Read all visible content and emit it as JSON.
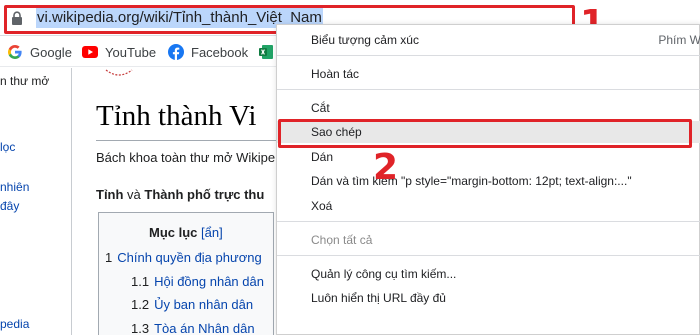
{
  "address_bar": {
    "url": "vi.wikipedia.org/wiki/Tỉnh_thành_Việt_Nam"
  },
  "annotations": {
    "step1": "1",
    "step2": "2"
  },
  "bookmarks": [
    {
      "label": "Google",
      "icon": "google-icon"
    },
    {
      "label": "YouTube",
      "icon": "youtube-icon"
    },
    {
      "label": "Facebook",
      "icon": "facebook-icon"
    },
    {
      "label": "",
      "icon": "excel-icon"
    }
  ],
  "left_rail": {
    "lines": [
      "n thư mở",
      "lọc",
      "nhiên",
      "đây",
      "pedia"
    ]
  },
  "article": {
    "title": "Tỉnh thành Vi",
    "subtitle": "Bách khoa toàn thư mở Wikipe",
    "lead_bold_1": "Tỉnh",
    "lead_and": " và ",
    "lead_bold_2": "Thành phố trực thu"
  },
  "toc": {
    "title": "Mục lục",
    "toggle": "[ẩn]",
    "items": [
      {
        "num": "1",
        "label": "Chính quyền địa phương"
      },
      {
        "num": "1.1",
        "label": "Hội đồng nhân dân"
      },
      {
        "num": "1.2",
        "label": "Ủy ban nhân dân"
      },
      {
        "num": "1.3",
        "label": "Tòa án Nhân dân"
      }
    ]
  },
  "context_menu": {
    "emoji": "Biểu tượng cảm xúc",
    "emoji_shortcut": "Phím W",
    "undo": "Hoàn tác",
    "cut": "Cắt",
    "copy": "Sao chép",
    "paste": "Dán",
    "paste_search": "Dán và tìm kiếm \"p style=\"margin-bottom: 12pt; text-align:...\"",
    "delete": "Xoá",
    "select_all": "Chọn tất cả",
    "manage_search": "Quản lý công cụ tìm kiếm...",
    "always_full_url": "Luôn hiển thị URL đầy đủ"
  },
  "colors": {
    "highlight_red": "#e02328",
    "url_selection": "#bbd6fb",
    "link_blue": "#0645ad"
  }
}
